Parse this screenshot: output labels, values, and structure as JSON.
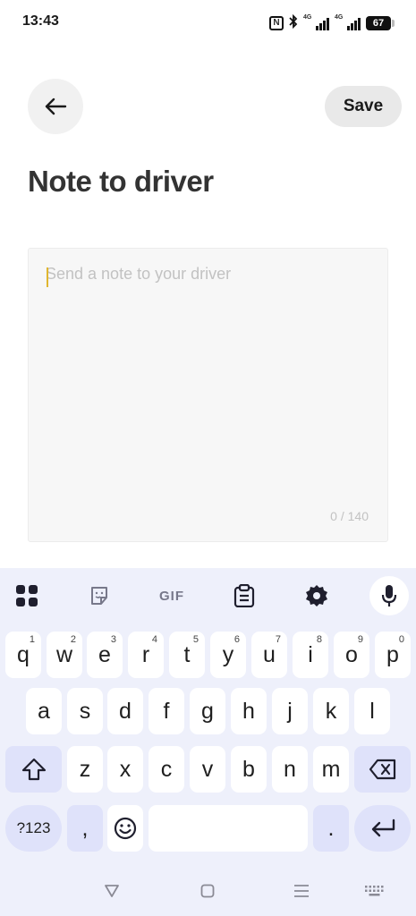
{
  "status_bar": {
    "time": "13:43",
    "nfc_label": "N",
    "signal1_label": "4G",
    "signal2_label": "4G",
    "battery": "67"
  },
  "header": {
    "back_icon": "arrow-left-icon",
    "save_label": "Save",
    "title": "Note to driver"
  },
  "note": {
    "placeholder": "Send a note to your driver",
    "value": "",
    "counter": "0 / 140",
    "caret_color": "#e0b62f"
  },
  "keyboard": {
    "toolbar": [
      "apps-grid-icon",
      "sticker-icon",
      "gif-icon",
      "clipboard-icon",
      "settings-icon",
      "mic-icon"
    ],
    "gif_label": "GIF",
    "row1": [
      {
        "key": "q",
        "num": "1"
      },
      {
        "key": "w",
        "num": "2"
      },
      {
        "key": "e",
        "num": "3"
      },
      {
        "key": "r",
        "num": "4"
      },
      {
        "key": "t",
        "num": "5"
      },
      {
        "key": "y",
        "num": "6"
      },
      {
        "key": "u",
        "num": "7"
      },
      {
        "key": "i",
        "num": "8"
      },
      {
        "key": "o",
        "num": "9"
      },
      {
        "key": "p",
        "num": "0"
      }
    ],
    "row2": [
      "a",
      "s",
      "d",
      "f",
      "g",
      "h",
      "j",
      "k",
      "l"
    ],
    "row3": [
      "z",
      "x",
      "c",
      "v",
      "b",
      "n",
      "m"
    ],
    "symbols_label": "?123",
    "comma_label": ",",
    "period_label": ".",
    "accent": "#dfe2fa"
  },
  "nav": [
    "back-triangle-icon",
    "home-square-icon",
    "recents-lines-icon",
    "keyboard-icon"
  ]
}
